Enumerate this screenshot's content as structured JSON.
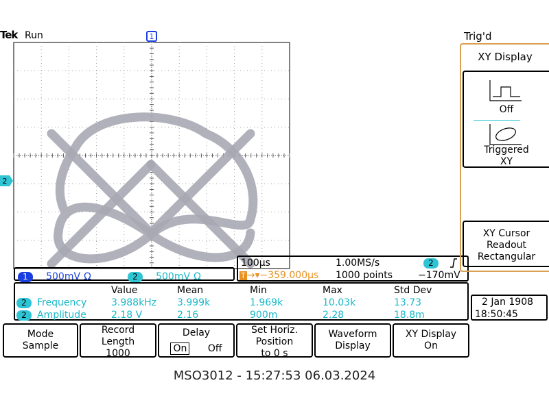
{
  "header": {
    "brand": "Tek",
    "run_status": "Run",
    "trigger_status": "Trig'd"
  },
  "channel_markers": {
    "ch1_top": "1",
    "ch2_left": "2"
  },
  "channels": [
    {
      "number": "1",
      "scale": "500mV",
      "coupling_icon": "Ω",
      "color": "#1a3ee0"
    },
    {
      "number": "2",
      "scale": "500mV",
      "coupling_icon": "Ω",
      "color": "#2ec4d4"
    }
  ],
  "timebase": {
    "time_per_div": "100µs",
    "sample_rate": "1.00MS/s",
    "trigger_source": "2",
    "trigger_slope_icon": "rising-edge-icon",
    "trigger_position": "→▾−359.000µs",
    "record_points": "1000 points",
    "trigger_level": "−170mV"
  },
  "measurements": {
    "headers": [
      "Value",
      "Mean",
      "Min",
      "Max",
      "Std Dev"
    ],
    "rows": [
      {
        "channel": "2",
        "name": "Frequency",
        "value": "3.988kHz",
        "mean": "3.999k",
        "min": "1.969k",
        "max": "10.03k",
        "std_dev": "13.73"
      },
      {
        "channel": "2",
        "name": "Amplitude",
        "value": "2.18 V",
        "mean": "2.16",
        "min": "900m",
        "max": "2.28",
        "std_dev": "18.8m"
      }
    ]
  },
  "datetime": {
    "date": "2 Jan  1908",
    "time": "18:50:45"
  },
  "side_menu": {
    "title": "XY Display",
    "options": [
      {
        "label": "Off",
        "icon": "square-pulse-icon"
      },
      {
        "label_line1": "Triggered",
        "label_line2": "XY",
        "icon": "ellipse-xy-icon"
      }
    ],
    "cursor": {
      "line1": "XY Cursor",
      "line2": "Readout",
      "line3": "Rectangular"
    }
  },
  "softkeys": {
    "mode": {
      "line1": "Mode",
      "line2": "Sample"
    },
    "record": {
      "line1": "Record",
      "line2": "Length",
      "line3": "1000"
    },
    "delay": {
      "line1": "Delay",
      "on": "On",
      "off": "Off"
    },
    "horiz": {
      "line1": "Set Horiz.",
      "line2": "Position",
      "line3": "to 0 s"
    },
    "waveform": {
      "line1": "Waveform",
      "line2": "Display"
    },
    "xy": {
      "line1": "XY Display",
      "line2": "On"
    }
  },
  "footer": "MSO3012 - 15:27:53   06.03.2024",
  "colors": {
    "trace": "#a8a8b4",
    "ch2": "#2ec4d4",
    "ch1": "#1a3ee0",
    "panel_border": "#d9a050"
  }
}
